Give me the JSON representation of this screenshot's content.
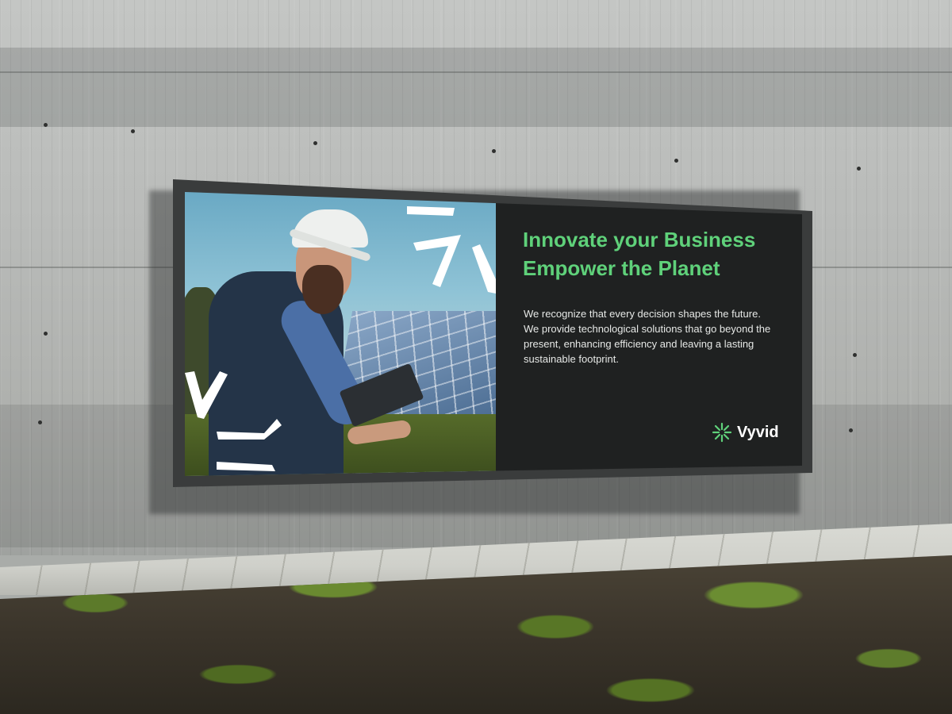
{
  "billboard": {
    "headline_line1": "Innovate your Business",
    "headline_line2": "Empower the Planet",
    "body_line1": "We recognize that every decision shapes the future.",
    "body_line2": "We provide technological solutions that go beyond the",
    "body_line3": "present, enhancing efficiency and leaving a lasting",
    "body_line4": "sustainable footprint.",
    "logo_text": "Vyvid",
    "logo_icon": "asterisk-burst-icon"
  },
  "colors": {
    "accent_green": "#5fd17a",
    "panel_dark": "#1f2121",
    "wall_concrete": "#b9bbb9"
  }
}
